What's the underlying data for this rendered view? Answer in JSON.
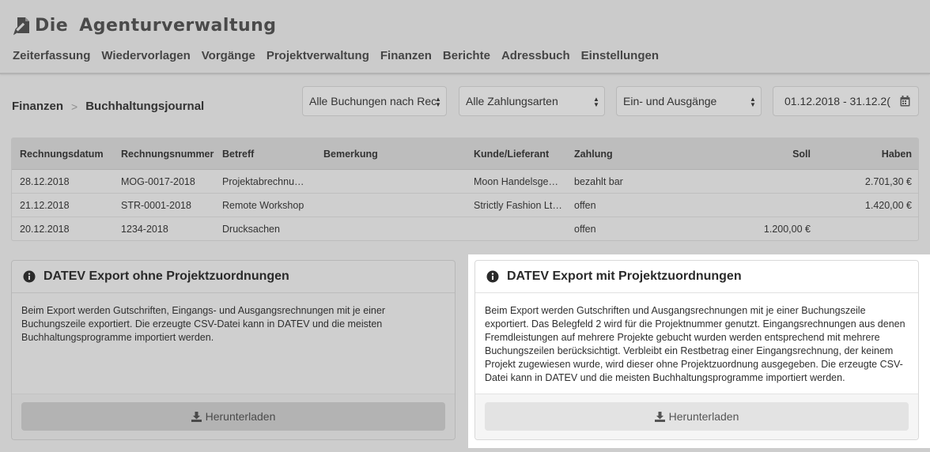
{
  "app": {
    "logo_word1": "Die",
    "logo_word2": "Agenturverwaltung",
    "logo_icon": "document-pen-icon"
  },
  "nav": [
    "Zeiterfassung",
    "Wiedervorlagen",
    "Vorgänge",
    "Projektverwaltung",
    "Finanzen",
    "Berichte",
    "Adressbuch",
    "Einstellungen"
  ],
  "breadcrumb": {
    "parent": "Finanzen",
    "current": "Buchhaltungsjournal"
  },
  "filters": {
    "bookings": "Alle Buchungen nach Rec",
    "payment_types": "Alle Zahlungsarten",
    "direction": "Ein- und Ausgänge",
    "date_range": "01.12.2018 - 31.12.2(",
    "date_icon": "calendar-icon"
  },
  "table": {
    "headers": [
      "Rechnungsdatum",
      "Rechnungsnummer",
      "Betreff",
      "Bemerkung",
      "Kunde/Lieferant",
      "Zahlung",
      "Soll",
      "Haben"
    ],
    "rows": [
      [
        "28.12.2018",
        "MOG-0017-2018",
        "Projektabrechnu…",
        "",
        "Moon Handelsges…",
        "bezahlt bar",
        "",
        "2.701,30 €"
      ],
      [
        "21.12.2018",
        "STR-0001-2018",
        "Remote Workshop",
        "",
        "Strictly Fashion Lt…",
        "offen",
        "",
        "1.420,00 €"
      ],
      [
        "20.12.2018",
        "1234-2018",
        "Drucksachen",
        "",
        "",
        "offen",
        "1.200,00 €",
        ""
      ]
    ]
  },
  "panels": {
    "left": {
      "title": "DATEV Export ohne Projektzuordnungen",
      "text": "Beim Export werden Gutschriften, Eingangs- und Ausgangsrechnungen mit je einer Buchungszeile exportiert. Die erzeugte CSV-Datei kann in DATEV und die meisten Buchhaltungsprogramme importiert werden.",
      "button": "Herunterladen"
    },
    "right": {
      "title": "DATEV Export mit Projektzuordnungen",
      "text": "Beim Export werden Gutschriften und Ausgangsrechnungen mit je einer Buchungszeile exportiert. Das Belegfeld 2 wird für die Projektnummer genutzt. Eingangsrechnungen aus denen Fremdleistungen auf mehrere Projekte gebucht wurden werden entsprechend mit mehrere Buchungszeilen berücksichtigt. Verbleibt ein Restbetrag einer Eingangsrechnung, der keinem Projekt zugewiesen wurde, wird dieser ohne Projektzuordnung ausgegeben. Die erzeugte CSV-Datei kann in DATEV und die meisten Buchhaltungsprogramme importiert werden.",
      "button": "Herunterladen"
    }
  },
  "colors": {
    "background": "#cdcdcd",
    "highlight_panel": "#ffffff",
    "table_header": "#bdbdbd"
  }
}
